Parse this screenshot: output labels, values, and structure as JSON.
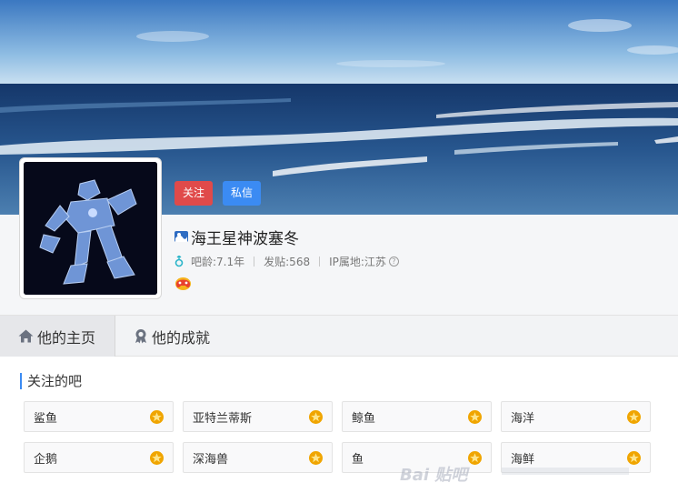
{
  "profile": {
    "username": "海王星神波塞冬",
    "follow_label": "关注",
    "message_label": "私信",
    "bar_age": "吧龄:7.1年",
    "posts": "发贴:568",
    "ip_location": "IP属地:江苏",
    "help_glyph": "?"
  },
  "tabs": [
    {
      "label": "他的主页",
      "icon": "home-icon",
      "active": true
    },
    {
      "label": "他的成就",
      "icon": "achievement-icon",
      "active": false
    }
  ],
  "followed": {
    "title": "关注的吧",
    "bars": [
      {
        "name": "鲨鱼"
      },
      {
        "name": "亚特兰蒂斯"
      },
      {
        "name": "鲸鱼"
      },
      {
        "name": "海洋"
      },
      {
        "name": "企鹅"
      },
      {
        "name": "深海兽"
      },
      {
        "name": "鱼"
      },
      {
        "name": "海鲜"
      }
    ]
  },
  "watermark": "Bai 贴吧",
  "colors": {
    "follow_button": "#e04a4a",
    "message_button": "#3b8bf3",
    "accent": "#3b8bf3",
    "star": "#f0a500"
  }
}
